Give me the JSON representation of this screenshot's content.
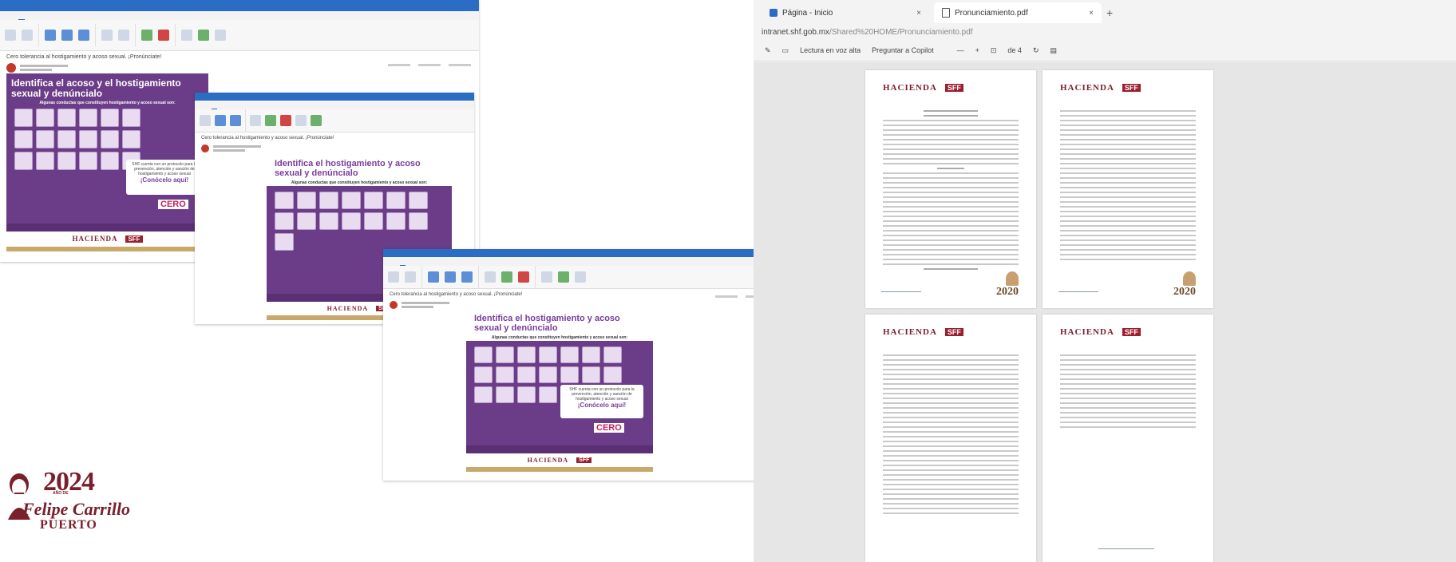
{
  "email": {
    "subject": "Cero tolerancia al hostigamiento y acoso sexual. ¡Pronúnciate!"
  },
  "poster": {
    "title_a": "Identifica el acoso y el hostigamiento sexual y denúncialo",
    "title_b": "Identifica el hostigamiento y acoso sexual y denúncialo",
    "subtitle": "Algunas conductas que constituyen hostigamiento y acoso sexual son:",
    "cta_text": "SHF cuenta con un protocolo para la prevención, atención y sanción de hostigamiento y acoso sexual",
    "cta_link": "¡Conócelo aquí!",
    "cero": "CERO",
    "hacienda": "HACIENDA",
    "sff": "SFF"
  },
  "browser": {
    "tabs": [
      {
        "label": "Página - Inicio",
        "close": "×"
      },
      {
        "label": "Pronunciamiento.pdf",
        "close": "×"
      }
    ],
    "new_tab": "+",
    "url_host": "intranet.shf.gob.mx",
    "url_path": "/Shared%20HOME/Pronunciamiento.pdf",
    "toolbar": {
      "read_aloud": "Lectura en voz alta",
      "ask_copilot": "Preguntar a Copilot",
      "zoom_out": "—",
      "zoom_in": "+",
      "page_of": "de 4"
    },
    "page_year": "2020",
    "page_header": "HACIENDA"
  },
  "logo": {
    "year": "2024",
    "year_small": "AÑO DE",
    "name_line1": "Felipe Carrillo",
    "name_line2": "PUERTO"
  }
}
